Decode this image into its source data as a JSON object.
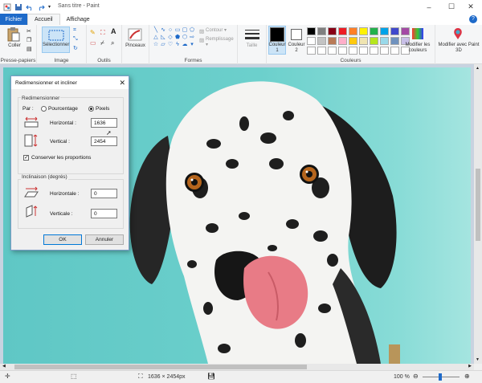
{
  "window": {
    "title": "Sans titre - Paint",
    "controls": [
      "–",
      "☐",
      "✕"
    ]
  },
  "tabs": [
    {
      "label": "Fichier"
    },
    {
      "label": "Accueil"
    },
    {
      "label": "Affichage"
    }
  ],
  "ribbon": {
    "groups": {
      "clipboard": "Presse-papiers",
      "image": "Image",
      "tools": "Outils",
      "shapes": "Formes",
      "colors": "Couleurs"
    },
    "paste_label": "Coller",
    "select_label": "Sélectionner",
    "brushes_label": "Pinceaux",
    "outline_label": "Contour ▾",
    "fill_label": "Remplissage ▾",
    "size_label": "Taille",
    "color1_label": "Couleur\n1",
    "color2_label": "Couleur\n2",
    "edit_colors_label": "Modifier les couleurs",
    "paint3d_label": "Modifier avec Paint 3D",
    "swatch_colors": [
      "#000000",
      "#7f7f7f",
      "#880015",
      "#ed1c24",
      "#ff7f27",
      "#fff200",
      "#22b14c",
      "#00a2e8",
      "#3f48cc",
      "#a349a4",
      "#ffffff",
      "#c3c3c3",
      "#b97a57",
      "#ffaec9",
      "#ffc90e",
      "#efe4b0",
      "#b5e61d",
      "#99d9ea",
      "#7092be",
      "#c8bfe7",
      "#ffffff",
      "#ffffff",
      "#ffffff",
      "#ffffff",
      "#ffffff",
      "#ffffff",
      "#ffffff",
      "#ffffff",
      "#ffffff",
      "#ffffff"
    ]
  },
  "dialog": {
    "title": "Redimensionner et incliner",
    "resize_legend": "Redimensionner",
    "by_label": "Par :",
    "percent_label": "Pourcentage",
    "pixels_label": "Pixels",
    "horizontal_label": "Horizontal :",
    "horizontal_value": "1636",
    "vertical_label": "Vertical :",
    "vertical_value": "2454",
    "keep_ratio_label": "Conserver les proportions",
    "skew_legend": "Inclinaison (degrés)",
    "skew_h_label": "Horizontale :",
    "skew_h_value": "0",
    "skew_v_label": "Verticale :",
    "skew_v_value": "0",
    "ok_label": "OK",
    "cancel_label": "Annuler"
  },
  "status": {
    "dimensions": "1636 × 2454px",
    "zoom": "100 %"
  }
}
